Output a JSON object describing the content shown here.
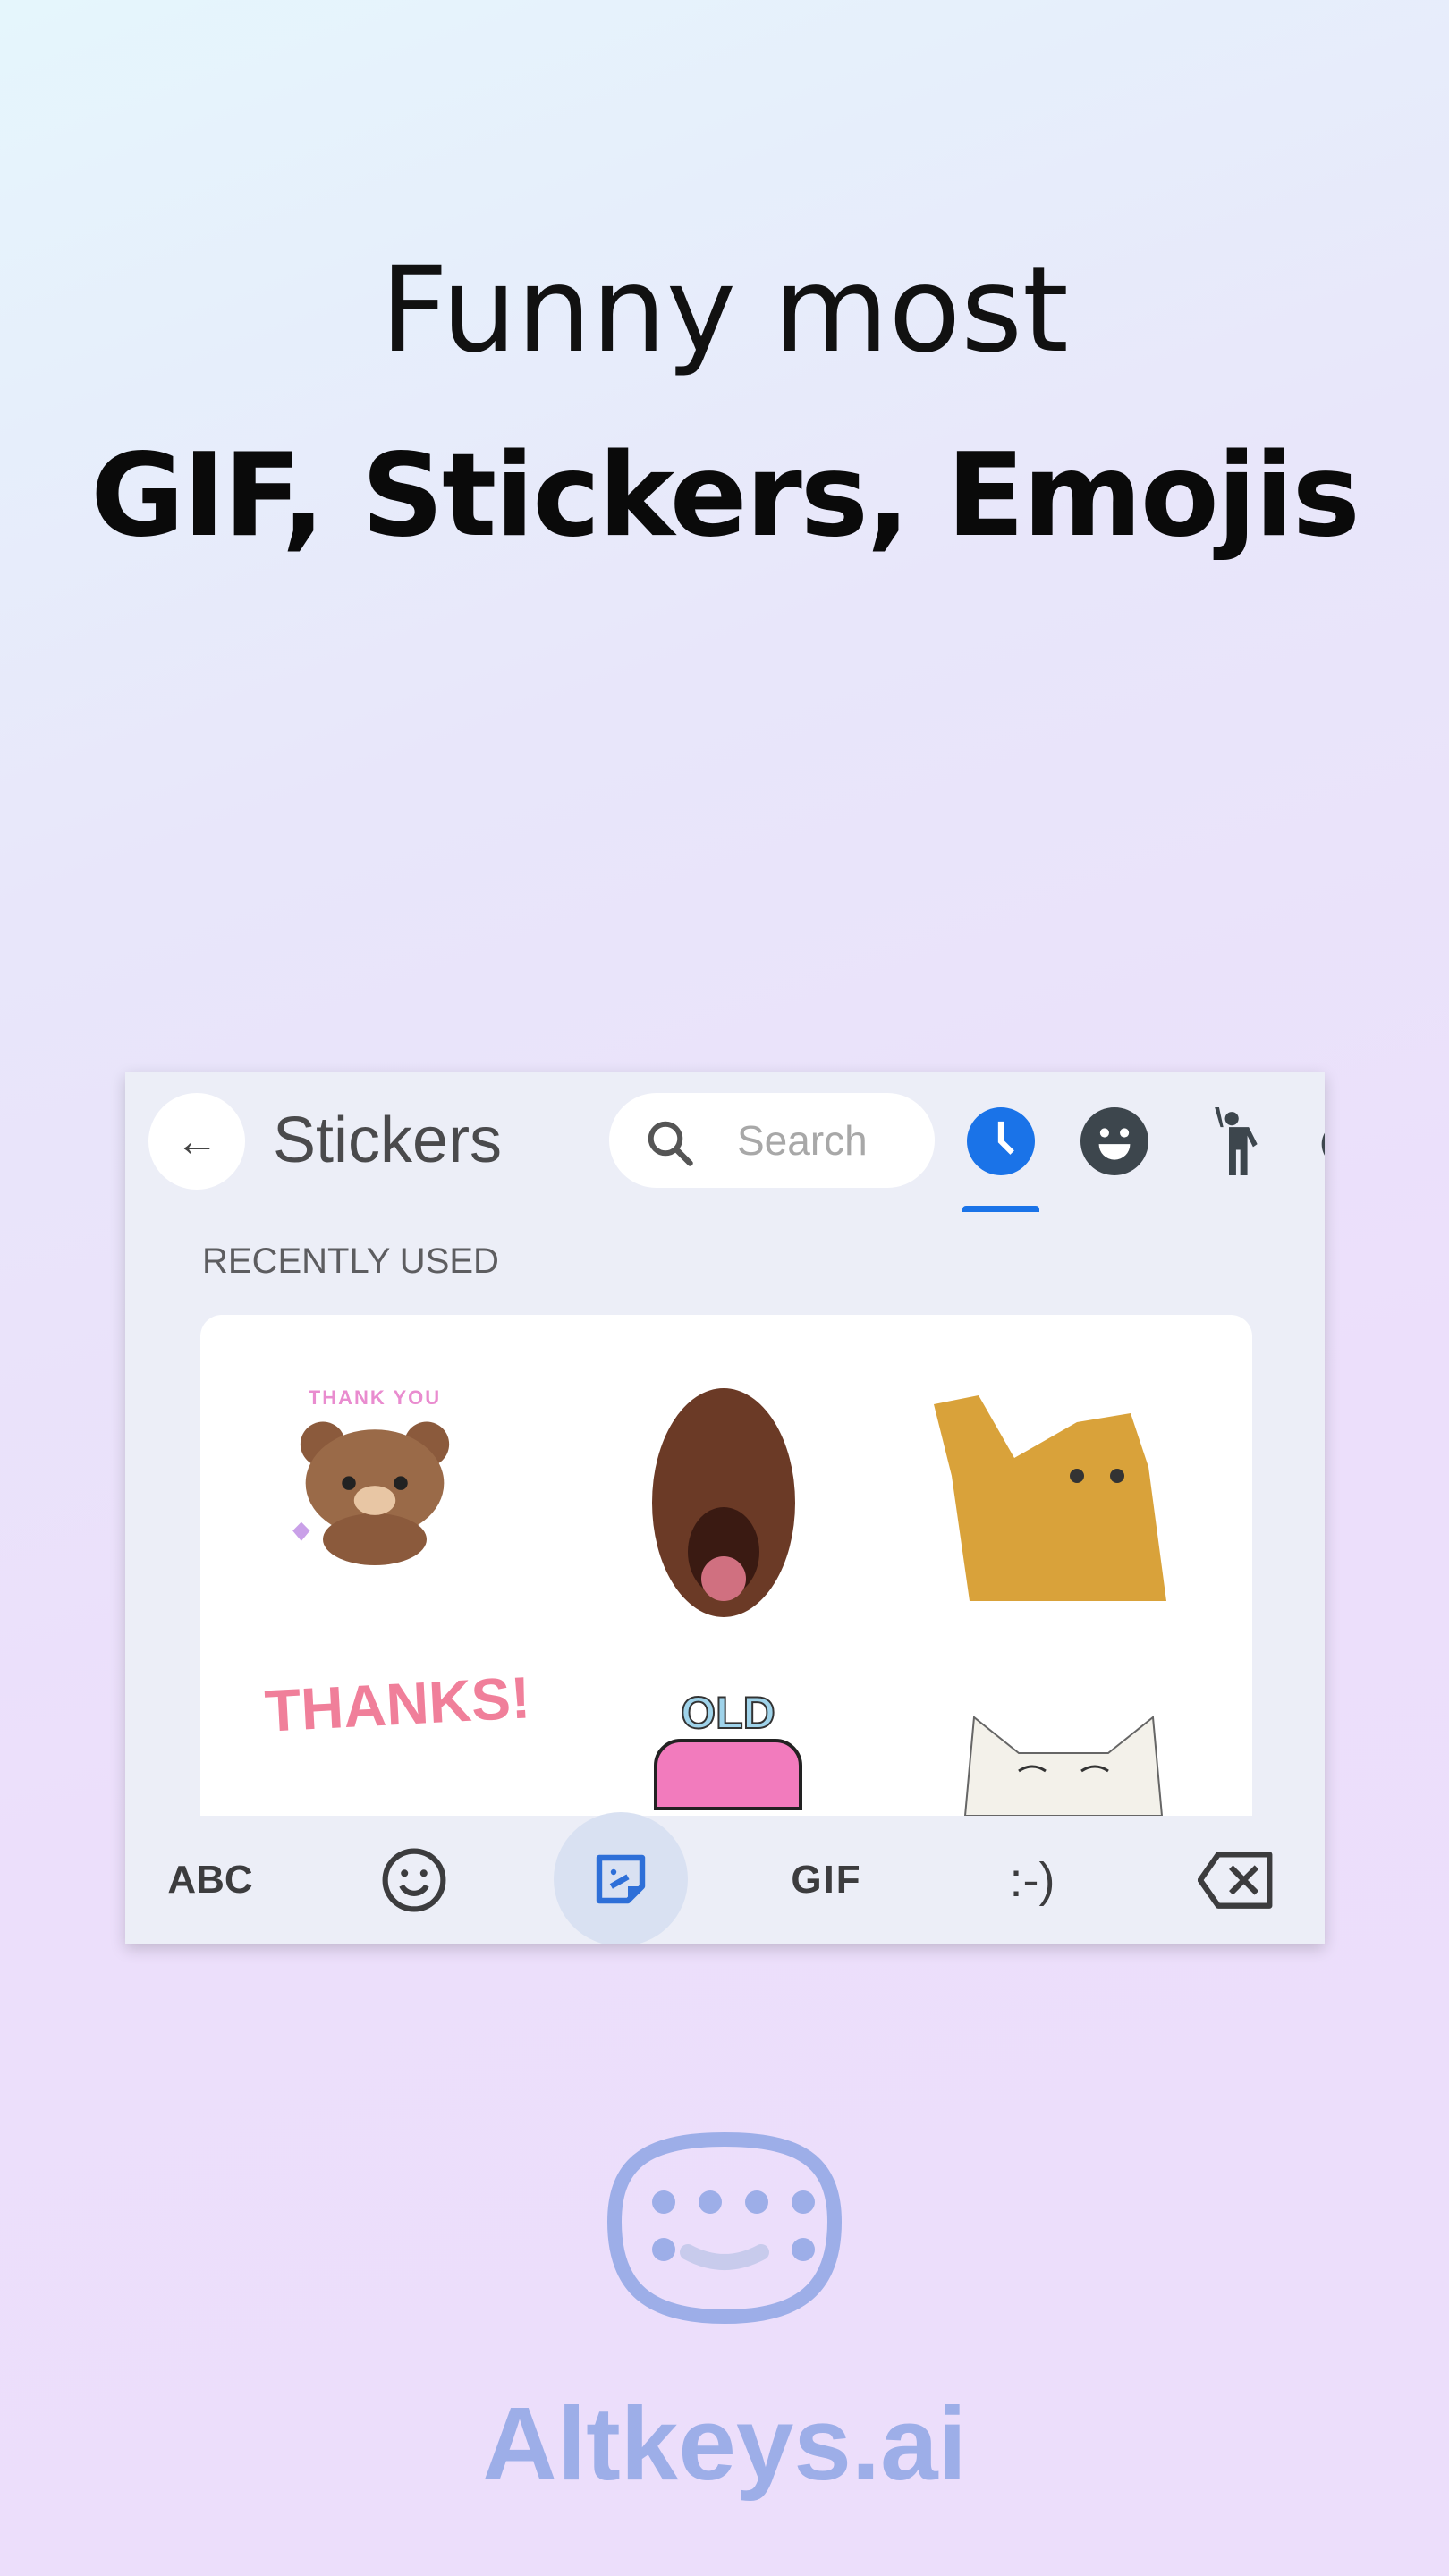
{
  "headline": {
    "line1": "Funny most",
    "line2": "GIF, Stickers, Emojis"
  },
  "keyboard": {
    "header": {
      "back_icon": "arrow-left-icon",
      "title": "Stickers",
      "search_placeholder": "Search",
      "categories": [
        {
          "icon": "clock-icon",
          "active": true
        },
        {
          "icon": "smiley-face-icon",
          "active": false
        },
        {
          "icon": "person-waving-icon",
          "active": false
        },
        {
          "icon": "partial-category-icon",
          "active": false
        }
      ]
    },
    "section_label": "RECENTLY USED",
    "stickers": [
      {
        "name": "bear-thank-you",
        "text": "THANK YOU"
      },
      {
        "name": "orangutan-face",
        "text": ""
      },
      {
        "name": "kitten-waving",
        "text": ""
      },
      {
        "name": "thanks-text",
        "text": "THANKS!"
      },
      {
        "name": "old-birthday-cake",
        "text": "OLD"
      },
      {
        "name": "white-cat-smiling",
        "text": ""
      }
    ],
    "bottom_bar": {
      "abc": "ABC",
      "emoji_icon": "smiley-icon",
      "sticker_icon": "sticker-icon",
      "gif": "GIF",
      "emoticon": ":-)",
      "backspace_icon": "backspace-icon"
    },
    "colors": {
      "accent": "#1a73e8",
      "active_bg": "#d9e1f2"
    }
  },
  "brand": {
    "name": "Altkeys.ai",
    "color": "#9daee8"
  }
}
